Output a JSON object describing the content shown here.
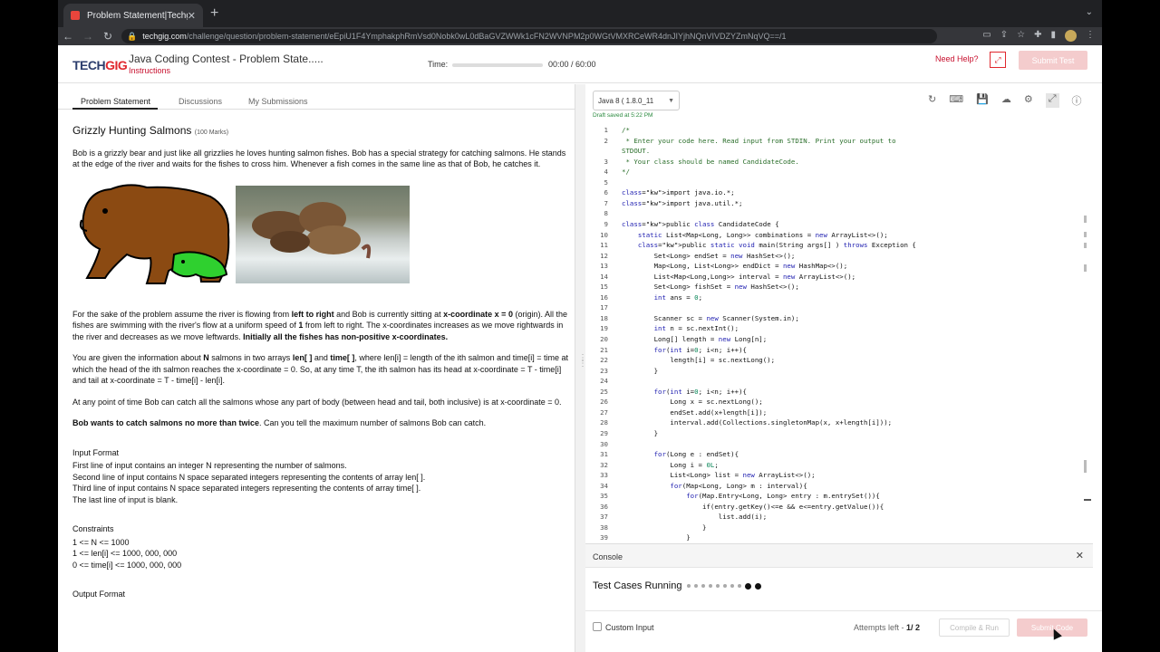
{
  "browser": {
    "tab_title": "Problem Statement|Techgig",
    "url_host": "techgig.com",
    "url_path": "/challenge/question/problem-statement/eEpiU1F4YmphakphRmVsd0Nobk0wL0dBaGVZWWk1cFN2WVNPM2p0WGtVMXRCeWR4dnJIYjhNQnVIVDZYZmNqVQ==/1"
  },
  "header": {
    "logo_main": "TECH",
    "logo_accent": "GIG",
    "contest_title": "Java Coding Contest - Problem State.....",
    "instructions": "Instructions",
    "time_label": "Time:",
    "time_value": "00:00 / 60:00",
    "time_progress": 0.0,
    "need_help": "Need Help?",
    "submit_test": "Submit Test"
  },
  "left_tabs": [
    "Problem Statement",
    "Discussions",
    "My Submissions"
  ],
  "problem": {
    "title": "Grizzly Hunting Salmons",
    "marks": "(100 Marks)",
    "intro": "Bob is a grizzly bear and just like all grizzlies he loves hunting salmon fishes. Bob has a special strategy for catching salmons. He stands at the edge of the river and waits for the fishes to cross him. Whenever a fish comes in the same line as that of Bob, he catches it.",
    "p1_a": "For the sake of the problem assume the river is flowing from ",
    "p1_b": "left to right",
    "p1_c": " and Bob is currently sitting at ",
    "p1_d": "x-coordinate x = 0",
    "p1_e": " (origin). All the fishes are swimming with the river's flow at a uniform speed of ",
    "p1_f": "1",
    "p1_g": " from left to right. The x-coordinates increases as we move rightwards in the river and decreases as we move leftwards. ",
    "p1_h": "Initially all the fishes has non-positive x-coordinates.",
    "p2_a": "You are given the information about ",
    "p2_b": "N",
    "p2_c": " salmons in two arrays ",
    "p2_d": "len[ ]",
    "p2_e": " and ",
    "p2_f": "time[ ]",
    "p2_g": ", where len[i] = length of the ith salmon and time[i] = time at which the head of the ith salmon reaches the x-coordinate = 0. So, at any time T, the ith salmon has its head at x-coordinate = T - time[i] and tail at x-coordinate = T - time[i] - len[i].",
    "p3": "At any point of time Bob can catch all the salmons whose any part of body (between head and tail, both inclusive) is at x-coordinate = 0.",
    "p4_a": "Bob wants to catch salmons no more than twice",
    "p4_b": ". Can you tell the maximum number of salmons Bob can catch.",
    "input_format_title": "Input Format",
    "input_format": [
      "First line of input contains an integer N representing the number of salmons.",
      "Second line of input contains N space separated integers representing the contents of array len[ ].",
      "Third line of input contains N space separated integers representing the contents of array time[ ].",
      "The last line of input is blank."
    ],
    "constraints_title": "Constraints",
    "constraints": [
      "1 <= N <= 1000",
      "1 <= len[i] <= 1000, 000, 000",
      "0 <= time[i] <= 1000, 000, 000"
    ],
    "output_format_title": "Output Format"
  },
  "editor": {
    "language": "Java 8 ( 1.8.0_11",
    "draft": "Draft saved at 5:22 PM",
    "lines": [
      {
        "n": "1",
        "t": "/*"
      },
      {
        "n": "2",
        "t": " * Enter your code here. Read input from STDIN. Print your output to"
      },
      {
        "n": "",
        "t": "STDOUT."
      },
      {
        "n": "3",
        "t": " * Your class should be named CandidateCode."
      },
      {
        "n": "4",
        "t": "*/"
      },
      {
        "n": "5",
        "t": ""
      },
      {
        "n": "6",
        "t": "import java.io.*;"
      },
      {
        "n": "7",
        "t": "import java.util.*;"
      },
      {
        "n": "8",
        "t": ""
      },
      {
        "n": "9",
        "t": "public class CandidateCode {"
      },
      {
        "n": "10",
        "t": "    static List<Map<Long, Long>> combinations = new ArrayList<>();"
      },
      {
        "n": "11",
        "t": "    public static void main(String args[] ) throws Exception {"
      },
      {
        "n": "12",
        "t": "        Set<Long> endSet = new HashSet<>();"
      },
      {
        "n": "13",
        "t": "        Map<Long, List<Long>> endDict = new HashMap<>();"
      },
      {
        "n": "14",
        "t": "        List<Map<Long,Long>> interval = new ArrayList<>();"
      },
      {
        "n": "15",
        "t": "        Set<Long> fishSet = new HashSet<>();"
      },
      {
        "n": "16",
        "t": "        int ans = 0;"
      },
      {
        "n": "17",
        "t": ""
      },
      {
        "n": "18",
        "t": "        Scanner sc = new Scanner(System.in);"
      },
      {
        "n": "19",
        "t": "        int n = sc.nextInt();"
      },
      {
        "n": "20",
        "t": "        Long[] length = new Long[n];"
      },
      {
        "n": "21",
        "t": "        for(int i=0; i<n; i++){"
      },
      {
        "n": "22",
        "t": "            length[i] = sc.nextLong();"
      },
      {
        "n": "23",
        "t": "        }"
      },
      {
        "n": "24",
        "t": ""
      },
      {
        "n": "25",
        "t": "        for(int i=0; i<n; i++){"
      },
      {
        "n": "26",
        "t": "            Long x = sc.nextLong();"
      },
      {
        "n": "27",
        "t": "            endSet.add(x+length[i]);"
      },
      {
        "n": "28",
        "t": "            interval.add(Collections.singletonMap(x, x+length[i]));"
      },
      {
        "n": "29",
        "t": "        }"
      },
      {
        "n": "30",
        "t": ""
      },
      {
        "n": "31",
        "t": "        for(Long e : endSet){"
      },
      {
        "n": "32",
        "t": "            Long i = 0L;"
      },
      {
        "n": "33",
        "t": "            List<Long> list = new ArrayList<>();"
      },
      {
        "n": "34",
        "t": "            for(Map<Long, Long> m : interval){"
      },
      {
        "n": "35",
        "t": "                for(Map.Entry<Long, Long> entry : m.entrySet()){"
      },
      {
        "n": "36",
        "t": "                    if(entry.getKey()<=e && e<=entry.getValue()){"
      },
      {
        "n": "37",
        "t": "                        list.add(i);"
      },
      {
        "n": "38",
        "t": "                    }"
      },
      {
        "n": "39",
        "t": "                }"
      },
      {
        "n": "40",
        "t": "                if(list.size()>0){"
      }
    ]
  },
  "console": {
    "title": "Console",
    "status": "Test Cases Running"
  },
  "footer": {
    "custom_input": "Custom Input",
    "attempts_label": "Attempts left - ",
    "attempts_value": "1/ 2",
    "compile": "Compile & Run",
    "submit_code": "Submit Code"
  },
  "colors": {
    "brand_red": "#e0282e",
    "brand_blue": "#2c3e6d",
    "disabled_pink": "#f4cccd",
    "draft_green": "#2a8a3e"
  }
}
